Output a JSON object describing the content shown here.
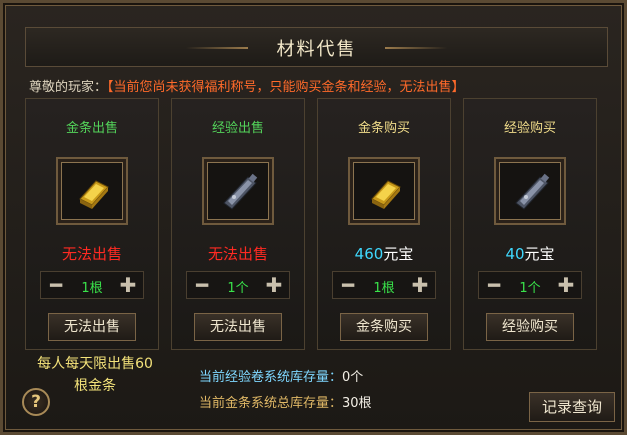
{
  "title": "材料代售",
  "notice": {
    "label": "尊敬的玩家：",
    "message": "【当前您尚未获得福利称号，只能购买金条和经验，无法出售】"
  },
  "cards": [
    {
      "title": "金条出售",
      "item": "gold-bar-icon",
      "status": "无法出售",
      "quantity": "1根",
      "button": "无法出售"
    },
    {
      "title": "经验出售",
      "item": "exp-scroll-icon",
      "status": "无法出售",
      "quantity": "1个",
      "button": "无法出售"
    },
    {
      "title": "金条购买",
      "item": "gold-bar-icon",
      "price": "460",
      "price_unit": "元宝",
      "quantity": "1根",
      "button": "金条购买"
    },
    {
      "title": "经验购买",
      "item": "exp-scroll-icon",
      "price": "40",
      "price_unit": "元宝",
      "quantity": "1个",
      "button": "经验购买"
    }
  ],
  "limit": {
    "line1": "每人每天限出售60",
    "line2": "根金条"
  },
  "stock": [
    {
      "label": "当前经验卷系统库存量：",
      "value": "0个"
    },
    {
      "label": "当前金条系统总库存量：",
      "value": "30根"
    }
  ],
  "help": "?",
  "records_button": "记录查询",
  "icons": {
    "minus": "minus-icon",
    "plus": "plus-icon"
  },
  "colors": {
    "title_green": "#53d35a",
    "title_gold": "#f0dc8a",
    "red": "#ff2a22",
    "price": "#3fd9ff",
    "quantity": "#39e24a"
  }
}
